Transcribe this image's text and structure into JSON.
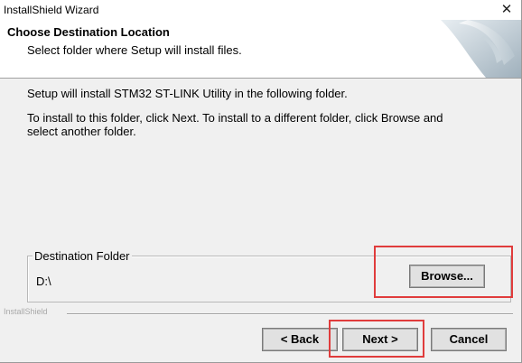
{
  "window": {
    "title": "InstallShield Wizard",
    "close_glyph": "✕"
  },
  "header": {
    "title": "Choose Destination Location",
    "subtitle": "Select folder where Setup will install files."
  },
  "body": {
    "line1": "Setup will install STM32 ST-LINK Utility in the following folder.",
    "line2": "To install to this folder, click Next. To install to a different folder, click Browse and",
    "line3": "select another folder."
  },
  "destination": {
    "group_label": "Destination Folder",
    "path": "D:\\",
    "browse_label": "Browse..."
  },
  "footer": {
    "brand": "InstallShield",
    "back_label": "< Back",
    "next_label": "Next >",
    "cancel_label": "Cancel"
  },
  "highlight_color": "#e03c3c"
}
